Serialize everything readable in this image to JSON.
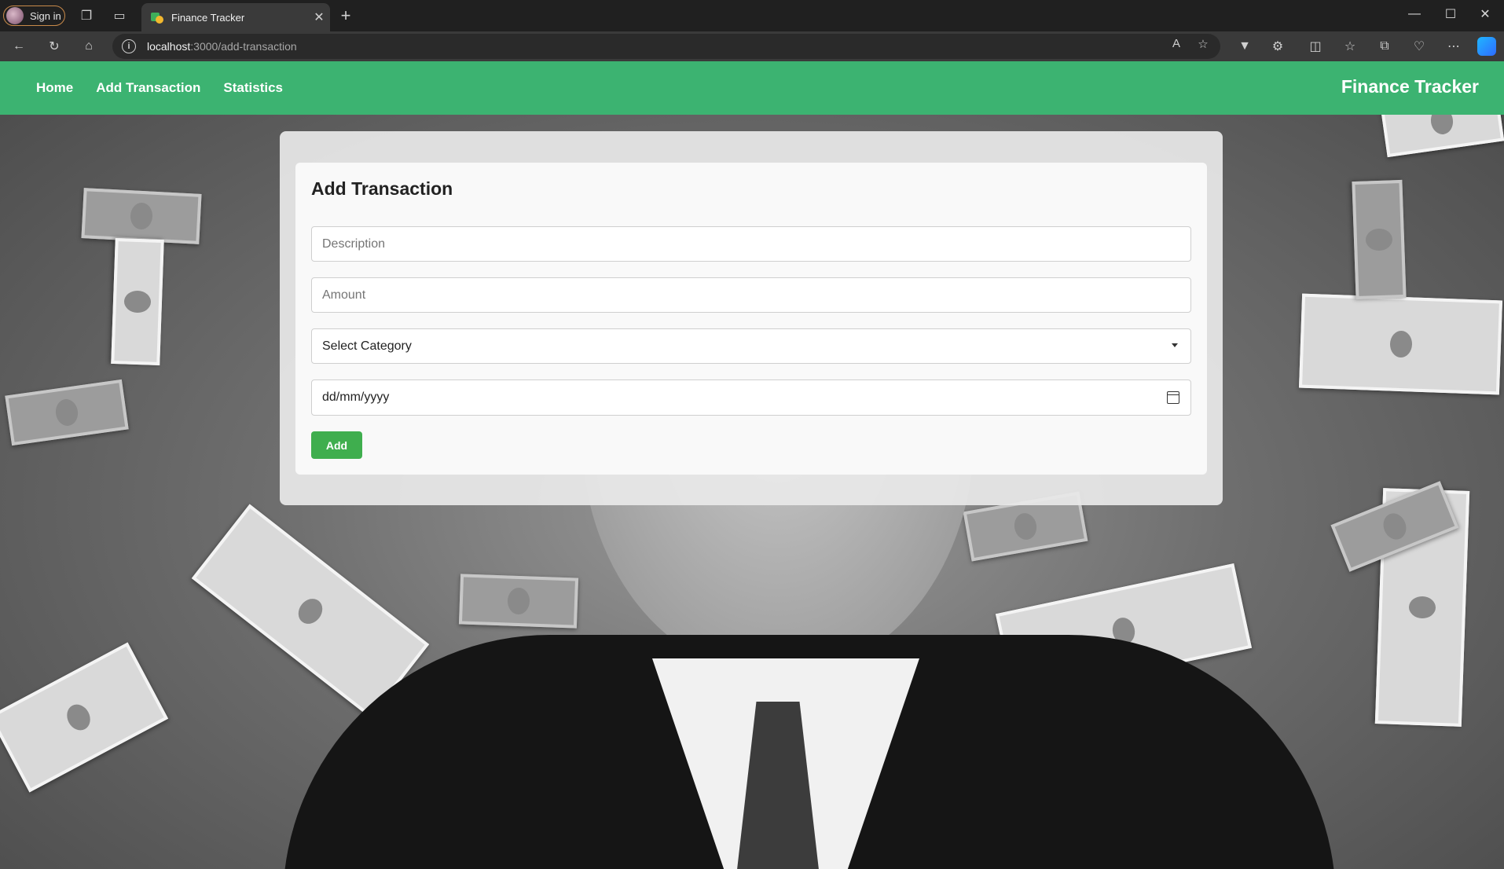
{
  "browser": {
    "profile_label": "Sign in",
    "tab_title": "Finance Tracker",
    "address_host": "localhost",
    "address_path": ":3000/add-transaction"
  },
  "navbar": {
    "links": [
      "Home",
      "Add Transaction",
      "Statistics"
    ],
    "brand": "Finance Tracker",
    "color": "#3cb371"
  },
  "form": {
    "title": "Add Transaction",
    "description_placeholder": "Description",
    "amount_placeholder": "Amount",
    "category_selected": "Select Category",
    "date_placeholder": "dd/mm/yyyy",
    "submit_label": "Add",
    "button_color": "#3fae4e"
  }
}
